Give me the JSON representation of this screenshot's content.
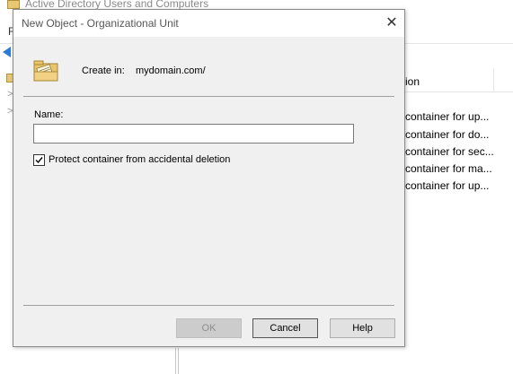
{
  "background": {
    "app_title": "Active Directory Users and Computers",
    "menu_first_letter": "F",
    "column_header": "ion",
    "descriptions": [
      "container for up...",
      "container for do...",
      "container for sec...",
      "container for ma...",
      "container for up..."
    ],
    "tree_chevrons": [
      ">",
      ">"
    ]
  },
  "dialog": {
    "title": "New Object - Organizational Unit",
    "close_glyph": "✕",
    "create_in_label": "Create in:",
    "create_in_value": "mydomain.com/",
    "name_label": "Name:",
    "name_value": "",
    "protect_label": "Protect container from accidental deletion",
    "protect_checked": true,
    "buttons": {
      "ok": "OK",
      "cancel": "Cancel",
      "help": "Help"
    }
  },
  "icons": {
    "ou": "organizational-unit-folder-icon",
    "close": "close-icon",
    "back": "back-arrow-icon",
    "check": "checkmark-icon"
  },
  "colors": {
    "dialog_bg": "#f0f0f0",
    "folder": "#e8c873",
    "accent_blue": "#2b7bd6"
  }
}
